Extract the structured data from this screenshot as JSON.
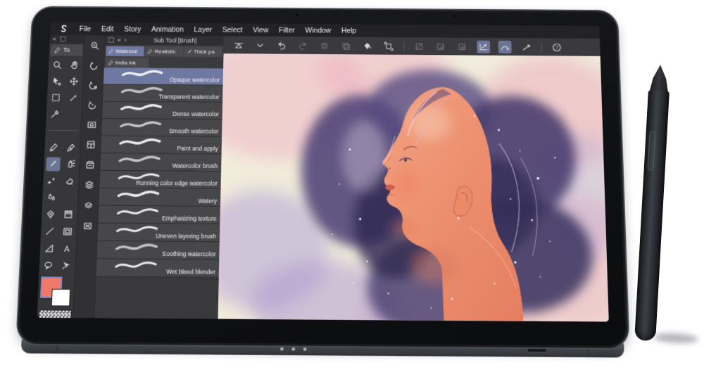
{
  "app": {
    "name": "paint-app",
    "menu": [
      "File",
      "Edit",
      "Story",
      "Animation",
      "Layer",
      "Select",
      "View",
      "Filter",
      "Window",
      "Help"
    ],
    "collapse": {
      "left": "«",
      "back": "«",
      "forward": "›"
    },
    "colors": {
      "foreground": "#F2796A",
      "background": "#FFFFFF",
      "selection_accent": "#6E78A0"
    },
    "tool_palette": {
      "tab_label": "To",
      "tools": [
        {
          "icon": "magnifier"
        },
        {
          "icon": "hand"
        },
        {
          "icon": "object-select"
        },
        {
          "icon": "move"
        },
        {
          "icon": "marquee"
        },
        {
          "icon": "magic-wand"
        },
        {
          "icon": "eyedropper"
        },
        {
          "icon": "blank",
          "blank": true
        },
        {
          "divider": true
        },
        {
          "icon": "pen"
        },
        {
          "icon": "marker-pen"
        },
        {
          "icon": "brush",
          "selected": true
        },
        {
          "icon": "airbrush"
        },
        {
          "icon": "decoration"
        },
        {
          "icon": "eraser"
        },
        {
          "icon": "blend"
        },
        {
          "icon": "blank",
          "blank": true
        },
        {
          "icon": "fill-area"
        },
        {
          "icon": "gradient"
        },
        {
          "icon": "figure-line"
        },
        {
          "icon": "frame-border"
        },
        {
          "icon": "ruler"
        },
        {
          "icon": "text"
        },
        {
          "icon": "balloon"
        },
        {
          "icon": "flow-line"
        }
      ]
    },
    "quick_strip": {
      "icons": [
        {
          "icon": "zoom-tool"
        },
        {
          "icon": "rotate-canvas",
          "boxed": true
        },
        {
          "icon": "rotate-settings"
        },
        {
          "icon": "rotate-reset"
        },
        {
          "icon": "navigator"
        },
        {
          "icon": "workspace"
        },
        {
          "icon": "material"
        },
        {
          "icon": "layer-stack"
        },
        {
          "icon": "layer-compose"
        },
        {
          "icon": "close-box"
        }
      ]
    },
    "subtool_panel": {
      "title": "Sub Tool [Brush]",
      "tabs_row1": [
        {
          "label": "Watercol",
          "icon": "pen-small",
          "selected": true
        },
        {
          "label": "Realistic",
          "icon": "pen-small"
        },
        {
          "label": "Thick pa",
          "icon": "brush-small"
        }
      ],
      "tabs_row2": [
        {
          "label": "India ink",
          "icon": "pen-small"
        }
      ],
      "brushes": [
        {
          "name": "Opaque watercolor",
          "selected": true,
          "texture": "smooth"
        },
        {
          "name": "Transparent watercolor",
          "texture": "soft"
        },
        {
          "name": "Dense watercolor",
          "texture": "smooth"
        },
        {
          "name": "Smooth watercolor",
          "texture": "soft"
        },
        {
          "name": "Paint and apply",
          "texture": "smooth"
        },
        {
          "name": "Watercolor brush",
          "texture": "soft"
        },
        {
          "name": "Running color edge watercolor",
          "texture": "rough"
        },
        {
          "name": "Watery",
          "texture": "smooth"
        },
        {
          "name": "Emphasizing texture",
          "texture": "rough"
        },
        {
          "name": "Uneven layering brush",
          "texture": "rough"
        },
        {
          "name": "Soothing watercolor",
          "texture": "soft"
        },
        {
          "name": "Wet bleed blender",
          "texture": "rough"
        }
      ]
    },
    "command_bar": {
      "icons": [
        {
          "icon": "flip-horizontal"
        },
        {
          "icon": "chevron-down"
        },
        {
          "icon": "undo"
        },
        {
          "icon": "redo",
          "state": "dimmed"
        },
        {
          "icon": "brightness",
          "state": "dimmed"
        },
        {
          "icon": "stamp",
          "state": "dimmed"
        },
        {
          "icon": "fill-bucket"
        },
        {
          "icon": "transform"
        },
        {
          "divider": true
        },
        {
          "icon": "select-none",
          "state": "dimmed"
        },
        {
          "icon": "select-half",
          "state": "dimmed"
        },
        {
          "icon": "select-rect",
          "state": "dimmed"
        },
        {
          "icon": "snap-angle",
          "state": "active"
        },
        {
          "icon": "snap-curve",
          "state": "active"
        },
        {
          "icon": "snap-line"
        },
        {
          "divider": true
        },
        {
          "icon": "help"
        }
      ]
    }
  }
}
